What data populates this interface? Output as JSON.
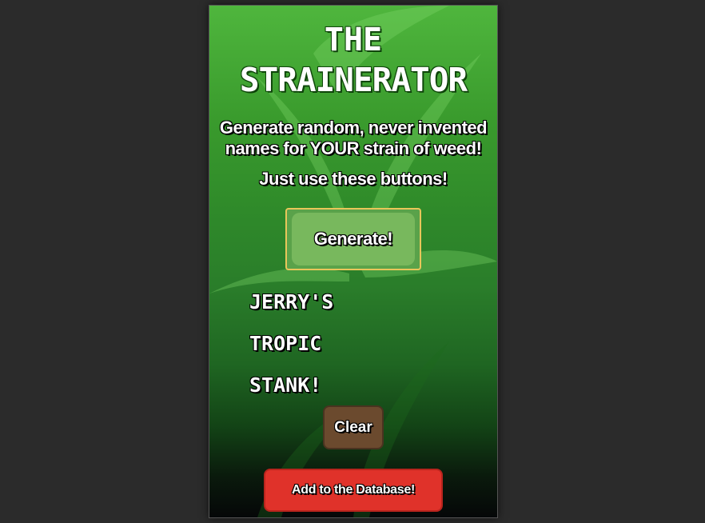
{
  "app": {
    "title_line1": "THE",
    "title_line2": "STRAINERATOR",
    "tagline": "Generate random, never invented names for YOUR strain of weed!",
    "instruction": "Just use these buttons!"
  },
  "buttons": {
    "generate_label": "Generate!",
    "clear_label": "Clear",
    "database_label": "Add to the Database!"
  },
  "generated_name": {
    "words": [
      "JERRY'S",
      "TROPIC",
      "STANK!"
    ]
  },
  "colors": {
    "background": "#2b2b2b",
    "generate_button": "#78b85d",
    "generate_border": "#e9c65a",
    "clear_button": "#6b4a2e",
    "database_button": "#e0322a"
  }
}
